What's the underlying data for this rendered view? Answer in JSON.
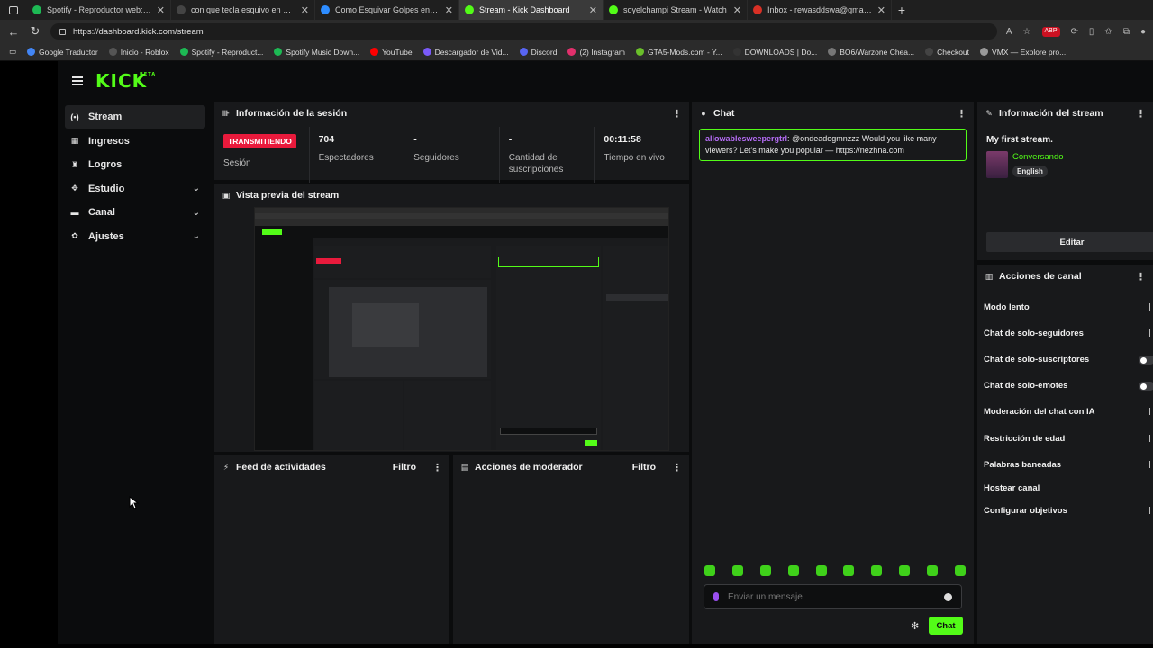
{
  "browser": {
    "tabs": [
      {
        "title": "Spotify - Reproductor web: músic",
        "color": "#1db954",
        "active": false
      },
      {
        "title": "con que tecla esquivo en gta 5 -",
        "color": "#444",
        "active": false
      },
      {
        "title": "Como Esquivar Golpes en GTA 5 c",
        "color": "#2d8cff",
        "active": false
      },
      {
        "title": "Stream - Kick Dashboard",
        "color": "#53fc18",
        "active": true
      },
      {
        "title": "soyelchampi Stream - Watch",
        "color": "#53fc18",
        "active": false
      },
      {
        "title": "Inbox - rewasddswa@gmail.com",
        "color": "#d93025",
        "active": false
      }
    ],
    "url": "https://dashboard.kick.com/stream",
    "bookmarks": [
      "Google Traductor",
      "Inicio - Roblox",
      "Spotify - Reproduct...",
      "Spotify Music Down...",
      "YouTube",
      "Descargador de Vid...",
      "Discord",
      "(2) Instagram",
      "GTA5-Mods.com - Y...",
      "DOWNLOADS | Do...",
      "BO6/Warzone Chea...",
      "Checkout",
      "VMX — Explore pro..."
    ]
  },
  "brand": {
    "logo": "KICK",
    "beta": "BETA",
    "accent": "#53fc18"
  },
  "sidebar": {
    "items": [
      {
        "label": "Stream",
        "icon": "broadcast-icon",
        "glyph": "(•)",
        "active": true,
        "chev": ""
      },
      {
        "label": "Ingresos",
        "icon": "revenue-icon",
        "glyph": "▦",
        "active": false,
        "chev": ""
      },
      {
        "label": "Logros",
        "icon": "trophy-icon",
        "glyph": "♜",
        "active": false,
        "chev": ""
      },
      {
        "label": "Estudio",
        "icon": "studio-icon",
        "glyph": "✥",
        "active": false,
        "chev": "⌄"
      },
      {
        "label": "Canal",
        "icon": "channel-icon",
        "glyph": "▬",
        "active": false,
        "chev": "⌄"
      },
      {
        "label": "Ajustes",
        "icon": "gear-icon",
        "glyph": "✿",
        "active": false,
        "chev": "⌄"
      }
    ]
  },
  "session": {
    "title": "Información de la sesión",
    "live_badge": "TRANSMITIENDO",
    "stats": [
      {
        "value": "",
        "caption": "Sesión"
      },
      {
        "value": "704",
        "caption": "Espectadores"
      },
      {
        "value": "-",
        "caption": "Seguidores"
      },
      {
        "value": "-",
        "caption": "Cantidad de suscripciones"
      },
      {
        "value": "00:11:58",
        "caption": "Tiempo en vivo"
      }
    ]
  },
  "preview": {
    "title": "Vista previa del stream"
  },
  "activity": {
    "title": "Feed de actividades",
    "filter": "Filtro"
  },
  "moderator": {
    "title": "Acciones de moderador",
    "filter": "Filtro"
  },
  "chat": {
    "title": "Chat",
    "messages": [
      {
        "user": "allowablesweepergtrl",
        "text": ": @ondeadogmnzzz Would you like many viewers? Let's make you popular — https://nezhna.com"
      }
    ],
    "placeholder": "Enviar un mensaje",
    "send_label": "Chat"
  },
  "stream_info": {
    "title": "Información del stream",
    "stream_title": "My first stream.",
    "category": "Conversando",
    "language": "English",
    "edit_label": "Editar"
  },
  "channel_actions": {
    "title": "Acciones de canal",
    "items": [
      {
        "label": "Modo lento",
        "control": "edge"
      },
      {
        "label": "Chat de solo-seguidores",
        "control": "edge"
      },
      {
        "label": "Chat de solo-suscriptores",
        "control": "toggle"
      },
      {
        "label": "Chat de solo-emotes",
        "control": "toggle"
      },
      {
        "label": "Moderación del chat con IA",
        "control": "edge"
      },
      {
        "label": "Restricción de edad",
        "control": "edge"
      },
      {
        "label": "Palabras baneadas",
        "control": "edge"
      },
      {
        "label": "Hostear canal",
        "control": "none"
      },
      {
        "label": "Configurar objetivos",
        "control": "edge"
      }
    ]
  }
}
